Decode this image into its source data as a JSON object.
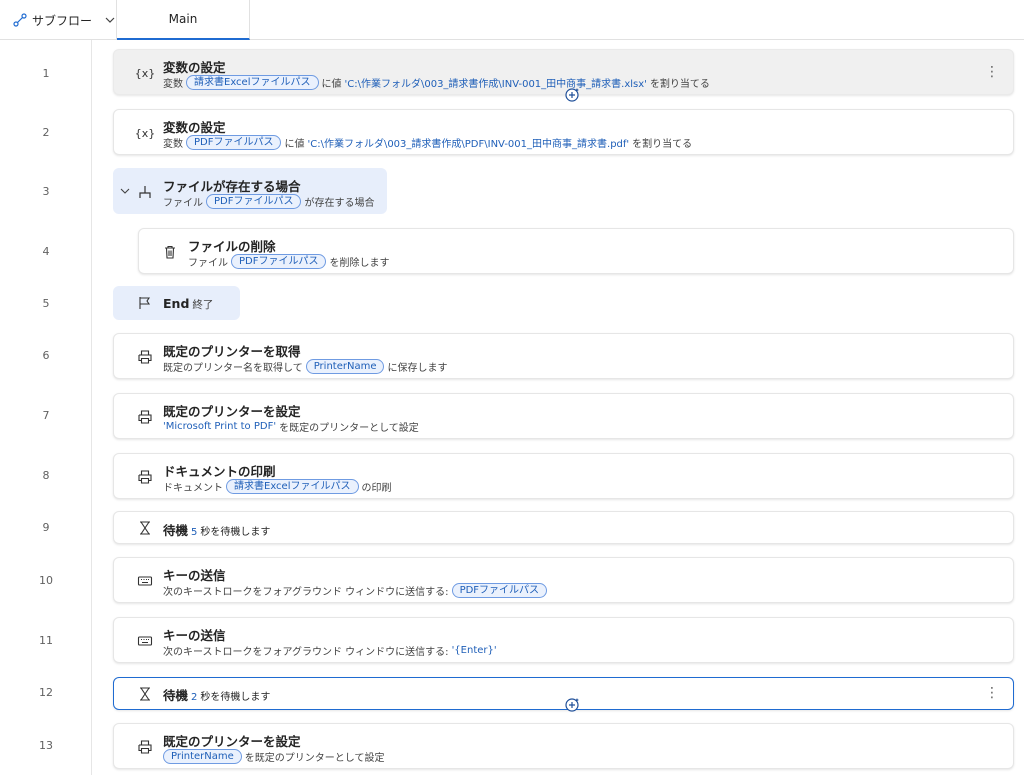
{
  "header": {
    "subflow_label": "サブフロー",
    "tab_main": "Main"
  },
  "rows": [
    {
      "num": "1",
      "title": "変数の設定",
      "d1": "変数",
      "pill": "請求書Excelファイルパス",
      "d2": "に値",
      "lit": "'C:\\作業フォルダ\\003_請求書作成\\INV-001_田中商事_請求書.xlsx'",
      "d3": "を割り当てる",
      "icon": "variable-icon"
    },
    {
      "num": "2",
      "title": "変数の設定",
      "d1": "変数",
      "pill": "PDFファイルパス",
      "d2": "に値",
      "lit": "'C:\\作業フォルダ\\003_請求書作成\\PDF\\INV-001_田中商事_請求書.pdf'",
      "d3": "を割り当てる",
      "icon": "variable-icon"
    },
    {
      "num": "3",
      "title": "ファイルが存在する場合",
      "d1": "ファイル",
      "pill": "PDFファイルパス",
      "d2": "が存在する場合",
      "icon": "if-branch-icon"
    },
    {
      "num": "4",
      "title": "ファイルの削除",
      "d1": "ファイル",
      "pill": "PDFファイルパス",
      "d2": "を削除します",
      "icon": "trash-icon"
    },
    {
      "num": "5",
      "title": "End",
      "sub": "終了",
      "icon": "flag-icon"
    },
    {
      "num": "6",
      "title": "既定のプリンターを取得",
      "d1": "既定のプリンター名を取得して",
      "pill": "PrinterName",
      "d2": "に保存します",
      "icon": "printer-icon"
    },
    {
      "num": "7",
      "title": "既定のプリンターを設定",
      "lit": "'Microsoft Print to PDF'",
      "d2": "を既定のプリンターとして設定",
      "icon": "printer-icon"
    },
    {
      "num": "8",
      "title": "ドキュメントの印刷",
      "d1": "ドキュメント",
      "pill": "請求書Excelファイルパス",
      "d2": "の印刷",
      "icon": "printer-icon"
    },
    {
      "num": "9",
      "title": "待機",
      "n": "5",
      "d2": "秒を待機します",
      "icon": "hourglass-icon"
    },
    {
      "num": "10",
      "title": "キーの送信",
      "d1": "次のキーストロークをフォアグラウンド ウィンドウに送信する:",
      "pill": "PDFファイルパス",
      "icon": "keyboard-icon"
    },
    {
      "num": "11",
      "title": "キーの送信",
      "d1": "次のキーストロークをフォアグラウンド ウィンドウに送信する:",
      "lit": "'{Enter}'",
      "icon": "keyboard-icon"
    },
    {
      "num": "12",
      "title": "待機",
      "n": "2",
      "d2": "秒を待機します",
      "icon": "hourglass-icon"
    },
    {
      "num": "13",
      "title": "既定のプリンターを設定",
      "pill": "PrinterName",
      "d2": "を既定のプリンターとして設定",
      "icon": "printer-icon"
    }
  ],
  "colors": {
    "accent": "#1f6bd1",
    "pill_border": "#6f9be2",
    "pill_bg": "#eaf1fd",
    "block_bg": "#e7eefb"
  }
}
